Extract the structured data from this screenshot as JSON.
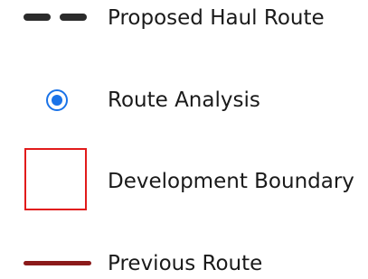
{
  "legend": {
    "items": [
      {
        "label": "Proposed Haul Route",
        "symbol": "dashed-line",
        "color": "#2b2b2b"
      },
      {
        "label": "Route Analysis",
        "symbol": "radio-dot",
        "color": "#1a73e8"
      },
      {
        "label": "Development Boundary",
        "symbol": "outlined-box",
        "color": "#e11b1b"
      },
      {
        "label": "Previous Route",
        "symbol": "solid-line",
        "color": "#8b1a1a"
      }
    ]
  }
}
